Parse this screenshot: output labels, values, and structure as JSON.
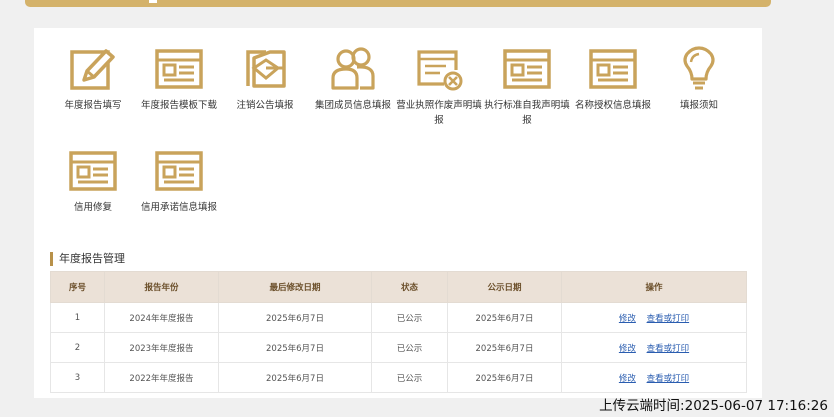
{
  "colors": {
    "gold": "#c9a35b",
    "link": "#2a5db0",
    "header_bg": "#ebe1d7"
  },
  "grid": [
    {
      "icon": "edit-icon",
      "label": "年度报告填写"
    },
    {
      "icon": "template-download-icon",
      "label": "年度报告模板下载"
    },
    {
      "icon": "cancel-notice-icon",
      "label": "注销公告填报"
    },
    {
      "icon": "group-members-icon",
      "label": "集团成员信息填报"
    },
    {
      "icon": "license-void-icon",
      "label": "营业执照作废声明填报"
    },
    {
      "icon": "standard-declaration-icon",
      "label": "执行标准自我声明填报"
    },
    {
      "icon": "name-authorization-icon",
      "label": "名称授权信息填报"
    },
    {
      "icon": "lightbulb-icon",
      "label": "填报须知"
    },
    {
      "icon": "credit-repair-icon",
      "label": "信用修复"
    },
    {
      "icon": "credit-commitment-icon",
      "label": "信用承诺信息填报"
    }
  ],
  "section": {
    "title": "年度报告管理"
  },
  "table": {
    "headers": [
      "序号",
      "报告年份",
      "最后修改日期",
      "状态",
      "公示日期",
      "操作"
    ],
    "rows": [
      {
        "no": "1",
        "year": "2024年年度报告",
        "modified": "2025年6月7日",
        "status": "已公示",
        "published": "2025年6月7日",
        "edit": "修改",
        "view": "查看或打印"
      },
      {
        "no": "2",
        "year": "2023年年度报告",
        "modified": "2025年6月7日",
        "status": "已公示",
        "published": "2025年6月7日",
        "edit": "修改",
        "view": "查看或打印"
      },
      {
        "no": "3",
        "year": "2022年年度报告",
        "modified": "2025年6月7日",
        "status": "已公示",
        "published": "2025年6月7日",
        "edit": "修改",
        "view": "查看或打印"
      }
    ]
  },
  "timestamp": "上传云端时间:2025-06-07 17:16:26"
}
